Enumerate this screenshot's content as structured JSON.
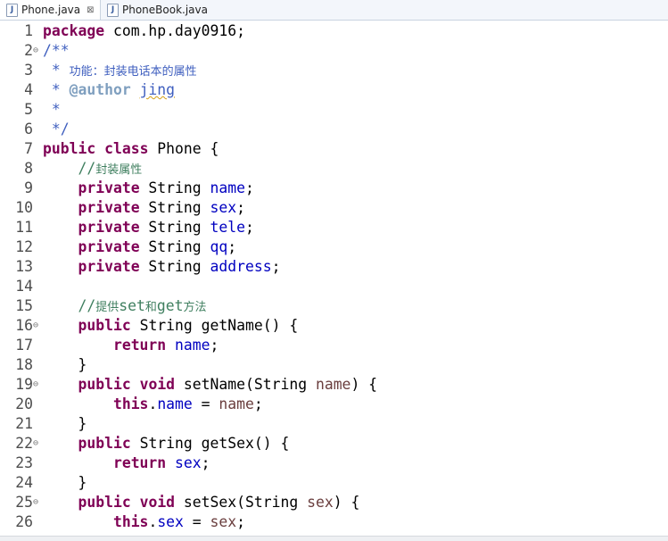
{
  "tabs": [
    {
      "label": "Phone.java",
      "icon": "java-file-icon",
      "active": true,
      "close": "⊠"
    },
    {
      "label": "PhoneBook.java",
      "icon": "java-file-icon",
      "active": false
    }
  ],
  "code_lines": [
    {
      "n": "1",
      "fold": "",
      "segments": [
        [
          "kw",
          "package"
        ],
        [
          "",
          "com.hp.day0916;"
        ]
      ],
      "sep": [
        "",
        " "
      ]
    },
    {
      "n": "2",
      "fold": "⊖",
      "segments": [
        [
          "cm",
          "/**"
        ]
      ]
    },
    {
      "n": "3",
      "fold": "",
      "segments": [
        [
          "cm",
          " * "
        ],
        [
          "cm zh",
          "功能：封装电话本的属性"
        ]
      ]
    },
    {
      "n": "4",
      "fold": "",
      "segments": [
        [
          "cm",
          " * "
        ],
        [
          "tag",
          "@author"
        ],
        [
          "cm",
          " "
        ],
        [
          "cm squiggle",
          "jing"
        ]
      ]
    },
    {
      "n": "5",
      "fold": "",
      "segments": [
        [
          "cm",
          " *"
        ]
      ]
    },
    {
      "n": "6",
      "fold": "",
      "segments": [
        [
          "cm",
          " */"
        ]
      ]
    },
    {
      "n": "7",
      "fold": "",
      "segments": [
        [
          "kw",
          "public"
        ],
        [
          "",
          " "
        ],
        [
          "kw",
          "class"
        ],
        [
          "",
          " Phone {"
        ]
      ]
    },
    {
      "n": "8",
      "fold": "",
      "segments": [
        [
          "",
          "    "
        ],
        [
          "cm2",
          "//"
        ],
        [
          "cm2 zh",
          "封装属性"
        ]
      ]
    },
    {
      "n": "9",
      "fold": "",
      "segments": [
        [
          "",
          "    "
        ],
        [
          "kw",
          "private"
        ],
        [
          "",
          " String "
        ],
        [
          "fld",
          "name"
        ],
        [
          "",
          ";"
        ]
      ]
    },
    {
      "n": "10",
      "fold": "",
      "segments": [
        [
          "",
          "    "
        ],
        [
          "kw",
          "private"
        ],
        [
          "",
          " String "
        ],
        [
          "fld",
          "sex"
        ],
        [
          "",
          ";"
        ]
      ]
    },
    {
      "n": "11",
      "fold": "",
      "segments": [
        [
          "",
          "    "
        ],
        [
          "kw",
          "private"
        ],
        [
          "",
          " String "
        ],
        [
          "fld",
          "tele"
        ],
        [
          "",
          ";"
        ]
      ]
    },
    {
      "n": "12",
      "fold": "",
      "segments": [
        [
          "",
          "    "
        ],
        [
          "kw",
          "private"
        ],
        [
          "",
          " String "
        ],
        [
          "fld",
          "qq"
        ],
        [
          "",
          ";"
        ]
      ]
    },
    {
      "n": "13",
      "fold": "",
      "segments": [
        [
          "",
          "    "
        ],
        [
          "kw",
          "private"
        ],
        [
          "",
          " String "
        ],
        [
          "fld",
          "address"
        ],
        [
          "",
          ";"
        ]
      ]
    },
    {
      "n": "14",
      "fold": "",
      "segments": []
    },
    {
      "n": "15",
      "fold": "",
      "segments": [
        [
          "",
          "    "
        ],
        [
          "cm2",
          "//"
        ],
        [
          "cm2 zh",
          "提供"
        ],
        [
          "cm2",
          "set"
        ],
        [
          "cm2 zh",
          "和"
        ],
        [
          "cm2",
          "get"
        ],
        [
          "cm2 zh",
          "方法"
        ]
      ]
    },
    {
      "n": "16",
      "fold": "⊖",
      "segments": [
        [
          "",
          "    "
        ],
        [
          "kw",
          "public"
        ],
        [
          "",
          " String getName() {"
        ]
      ]
    },
    {
      "n": "17",
      "fold": "",
      "segments": [
        [
          "",
          "        "
        ],
        [
          "kw",
          "return"
        ],
        [
          "",
          " "
        ],
        [
          "fld",
          "name"
        ],
        [
          "",
          ";"
        ]
      ]
    },
    {
      "n": "18",
      "fold": "",
      "segments": [
        [
          "",
          "    }"
        ]
      ]
    },
    {
      "n": "19",
      "fold": "⊖",
      "segments": [
        [
          "",
          "    "
        ],
        [
          "kw",
          "public"
        ],
        [
          "",
          " "
        ],
        [
          "kw",
          "void"
        ],
        [
          "",
          " setName(String "
        ],
        [
          "par",
          "name"
        ],
        [
          "",
          ") {"
        ]
      ]
    },
    {
      "n": "20",
      "fold": "",
      "segments": [
        [
          "",
          "        "
        ],
        [
          "kw",
          "this"
        ],
        [
          "",
          "."
        ],
        [
          "fld",
          "name"
        ],
        [
          "",
          " = "
        ],
        [
          "par",
          "name"
        ],
        [
          "",
          ";"
        ]
      ]
    },
    {
      "n": "21",
      "fold": "",
      "segments": [
        [
          "",
          "    }"
        ]
      ]
    },
    {
      "n": "22",
      "fold": "⊖",
      "segments": [
        [
          "",
          "    "
        ],
        [
          "kw",
          "public"
        ],
        [
          "",
          " String getSex() {"
        ]
      ]
    },
    {
      "n": "23",
      "fold": "",
      "segments": [
        [
          "",
          "        "
        ],
        [
          "kw",
          "return"
        ],
        [
          "",
          " "
        ],
        [
          "fld",
          "sex"
        ],
        [
          "",
          ";"
        ]
      ]
    },
    {
      "n": "24",
      "fold": "",
      "segments": [
        [
          "",
          "    }"
        ]
      ]
    },
    {
      "n": "25",
      "fold": "⊖",
      "segments": [
        [
          "",
          "    "
        ],
        [
          "kw",
          "public"
        ],
        [
          "",
          " "
        ],
        [
          "kw",
          "void"
        ],
        [
          "",
          " setSex(String "
        ],
        [
          "par",
          "sex"
        ],
        [
          "",
          ") {"
        ]
      ]
    },
    {
      "n": "26",
      "fold": "",
      "segments": [
        [
          "",
          "        "
        ],
        [
          "kw",
          "this"
        ],
        [
          "",
          "."
        ],
        [
          "fld",
          "sex"
        ],
        [
          "",
          " = "
        ],
        [
          "par",
          "sex"
        ],
        [
          "",
          ";"
        ]
      ]
    }
  ]
}
